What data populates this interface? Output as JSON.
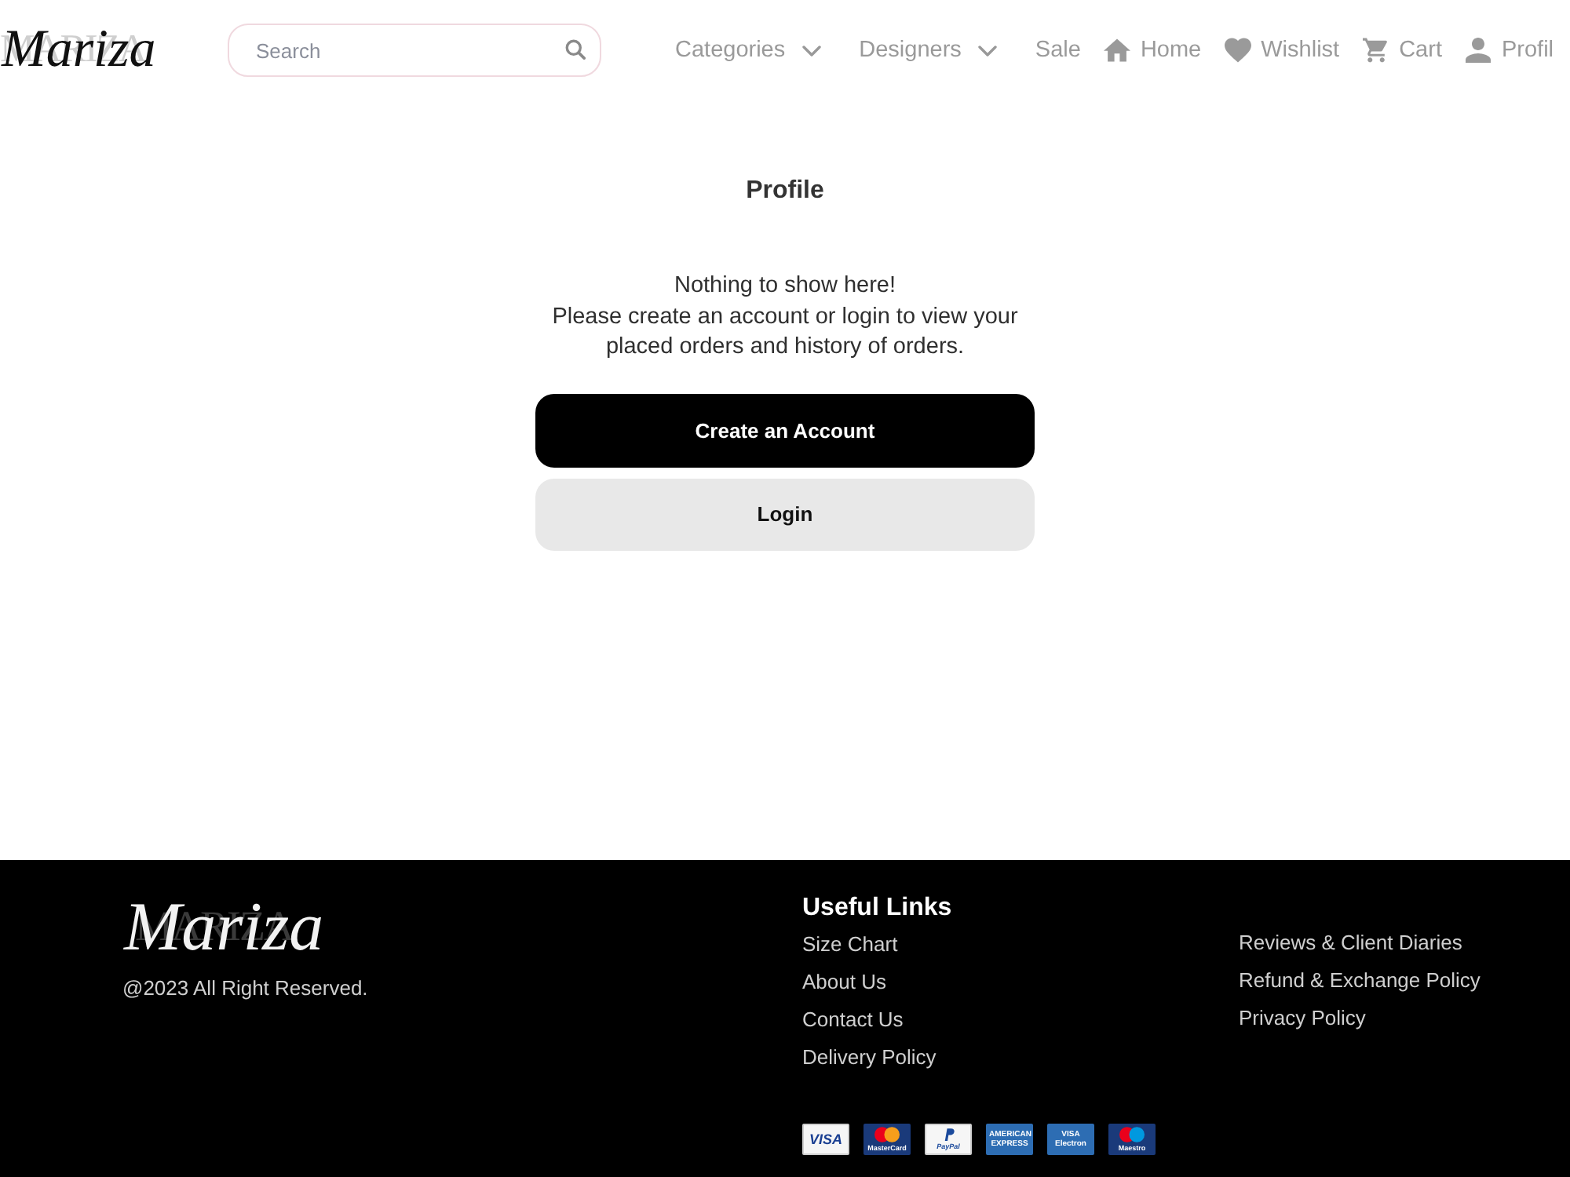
{
  "header": {
    "logo": {
      "text": "Mariza",
      "backdrop": "MARIZA"
    },
    "search": {
      "placeholder": "Search"
    },
    "nav": [
      {
        "kind": "dropdown",
        "label": "Categories"
      },
      {
        "kind": "dropdown",
        "label": "Designers"
      },
      {
        "kind": "link",
        "label": "Sale"
      },
      {
        "kind": "home",
        "label": "Home"
      },
      {
        "kind": "wishlist",
        "label": "Wishlist"
      },
      {
        "kind": "cart",
        "label": "Cart"
      },
      {
        "kind": "profile",
        "label": "Profil"
      }
    ]
  },
  "main": {
    "title": "Profile",
    "message": [
      "Nothing to show here!",
      "Please create an account or login to view your placed orders and history of orders."
    ],
    "buttons": [
      {
        "kind": "primary",
        "label": "Create an Account"
      },
      {
        "kind": "secondary",
        "label": "Login"
      }
    ]
  },
  "footer": {
    "logo": {
      "text": "Mariza",
      "backdrop": "MARIZA"
    },
    "copyright": "@2023 All Right Reserved.",
    "useful_links": {
      "title": "Useful Links",
      "columns": [
        [
          "Size Chart",
          "About Us",
          "Contact Us",
          "Delivery Policy"
        ],
        [
          "Reviews & Client Diaries",
          "Refund & Exchange Policy",
          "Privacy Policy"
        ]
      ]
    },
    "payment_cards": [
      {
        "kind": "light",
        "label": "VISA"
      },
      {
        "kind": "circles",
        "label": "MasterCard",
        "color": "#f79e1b"
      },
      {
        "kind": "mark",
        "label": "PayPal"
      },
      {
        "kind": "dark",
        "label": "AMERICAN EXPRESS"
      },
      {
        "kind": "dark",
        "label": "VISA Electron"
      },
      {
        "kind": "circles",
        "label": "Maestro",
        "color": "#0099df"
      }
    ]
  }
}
